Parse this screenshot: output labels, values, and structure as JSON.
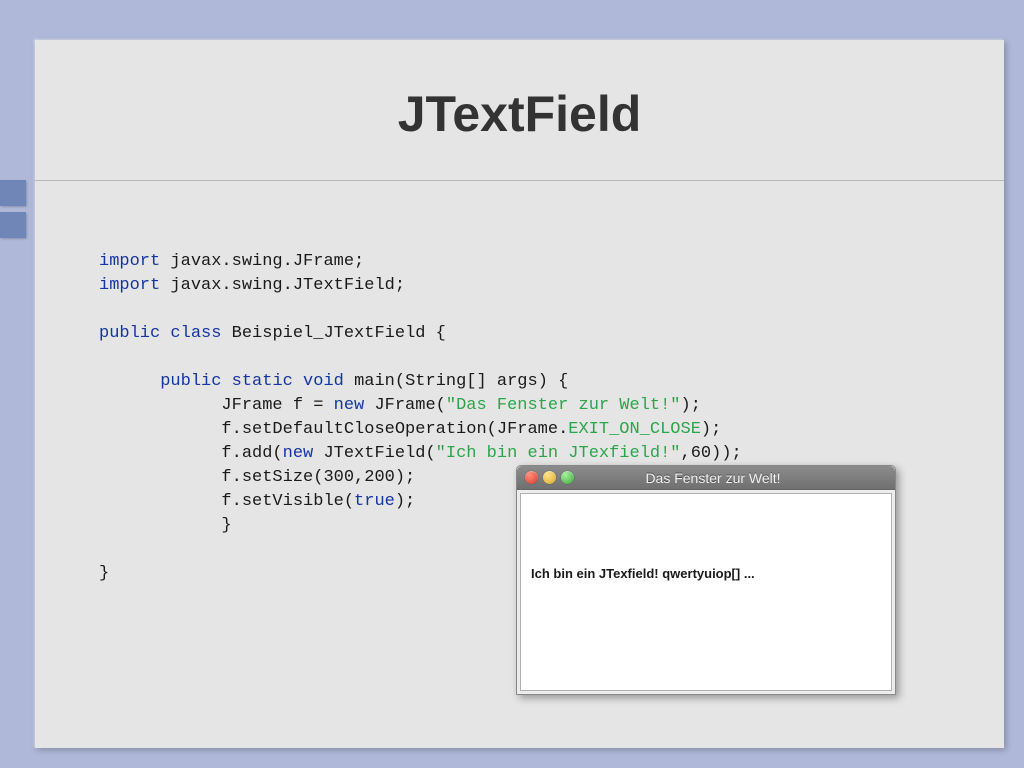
{
  "slide": {
    "title": "JTextField"
  },
  "code": {
    "l1_kw": "import",
    "l1_rest": " javax.swing.JFrame;",
    "l2_kw": "import",
    "l2_rest": " javax.swing.JTextField;",
    "l3_kw1": "public",
    "l3_kw2": " class",
    "l3_rest": " Beispiel_JTextField {",
    "l4_kw1": "public",
    "l4_kw2": " static",
    "l4_kw3": " void",
    "l4_rest": " main(String[] args) {",
    "l5a": "JFrame f = ",
    "l5_kw": "new",
    "l5b": " JFrame(",
    "l5_str": "\"Das Fenster zur Welt!\"",
    "l5c": ");",
    "l6a": "f.setDefaultCloseOperation(JFrame.",
    "l6_const": "EXIT_ON_CLOSE",
    "l6b": ");",
    "l7a": "f.add(",
    "l7_kw": "new",
    "l7b": " JTextField(",
    "l7_str": "\"Ich bin ein JTexfield!\"",
    "l7c": ",60));",
    "l8": "f.setSize(300,200);",
    "l9a": "f.setVisible(",
    "l9_kw": "true",
    "l9b": ");",
    "l10": "}",
    "l11": "}"
  },
  "jframe": {
    "title": "Das Fenster zur Welt!",
    "textfield_value": "Ich bin ein JTexfield! qwertyuiop[] ..."
  }
}
